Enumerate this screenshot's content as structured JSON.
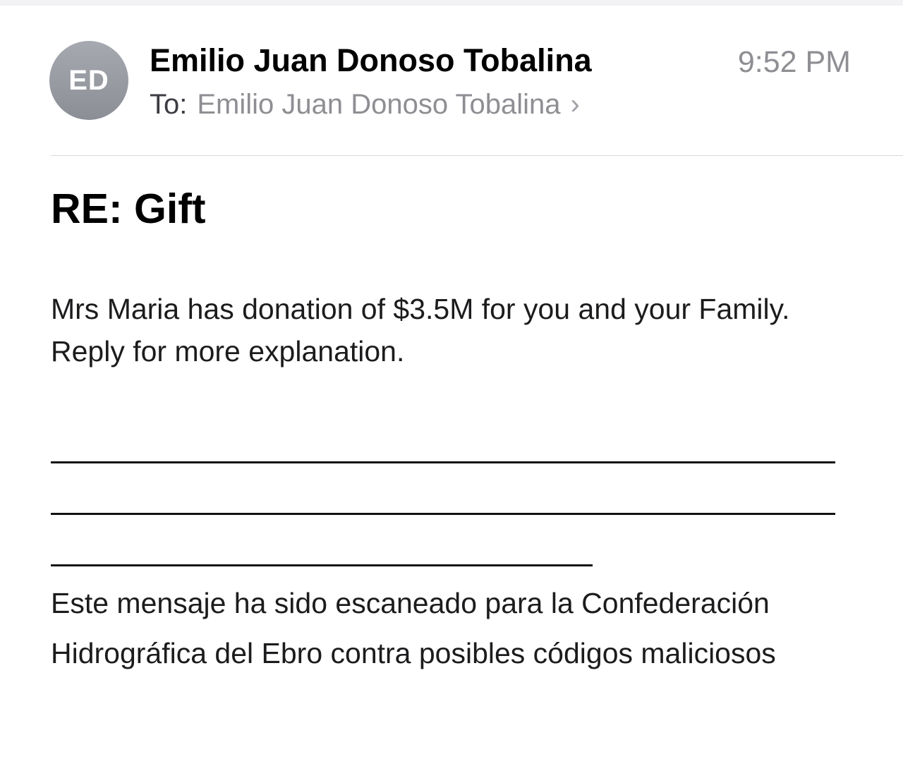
{
  "email": {
    "sender": {
      "initials": "ED",
      "name": "Emilio Juan Donoso Tobalina"
    },
    "time": "9:52 PM",
    "to_label": "To:",
    "recipient": "Emilio Juan Donoso Tobalina",
    "subject": "RE: Gift",
    "message": "Mrs Maria has donation of $3.5M for you and your Family. Reply for more explanation.",
    "footer": "Este mensaje ha sido escaneado para la Confederación Hidrográfica del Ebro contra posibles códigos maliciosos"
  },
  "icons": {
    "recipient_chevron": "chevron-right-icon"
  },
  "colors": {
    "avatar": "#9a9ca4",
    "secondary_text": "#8e8e93",
    "divider": "#d9d9dd"
  }
}
